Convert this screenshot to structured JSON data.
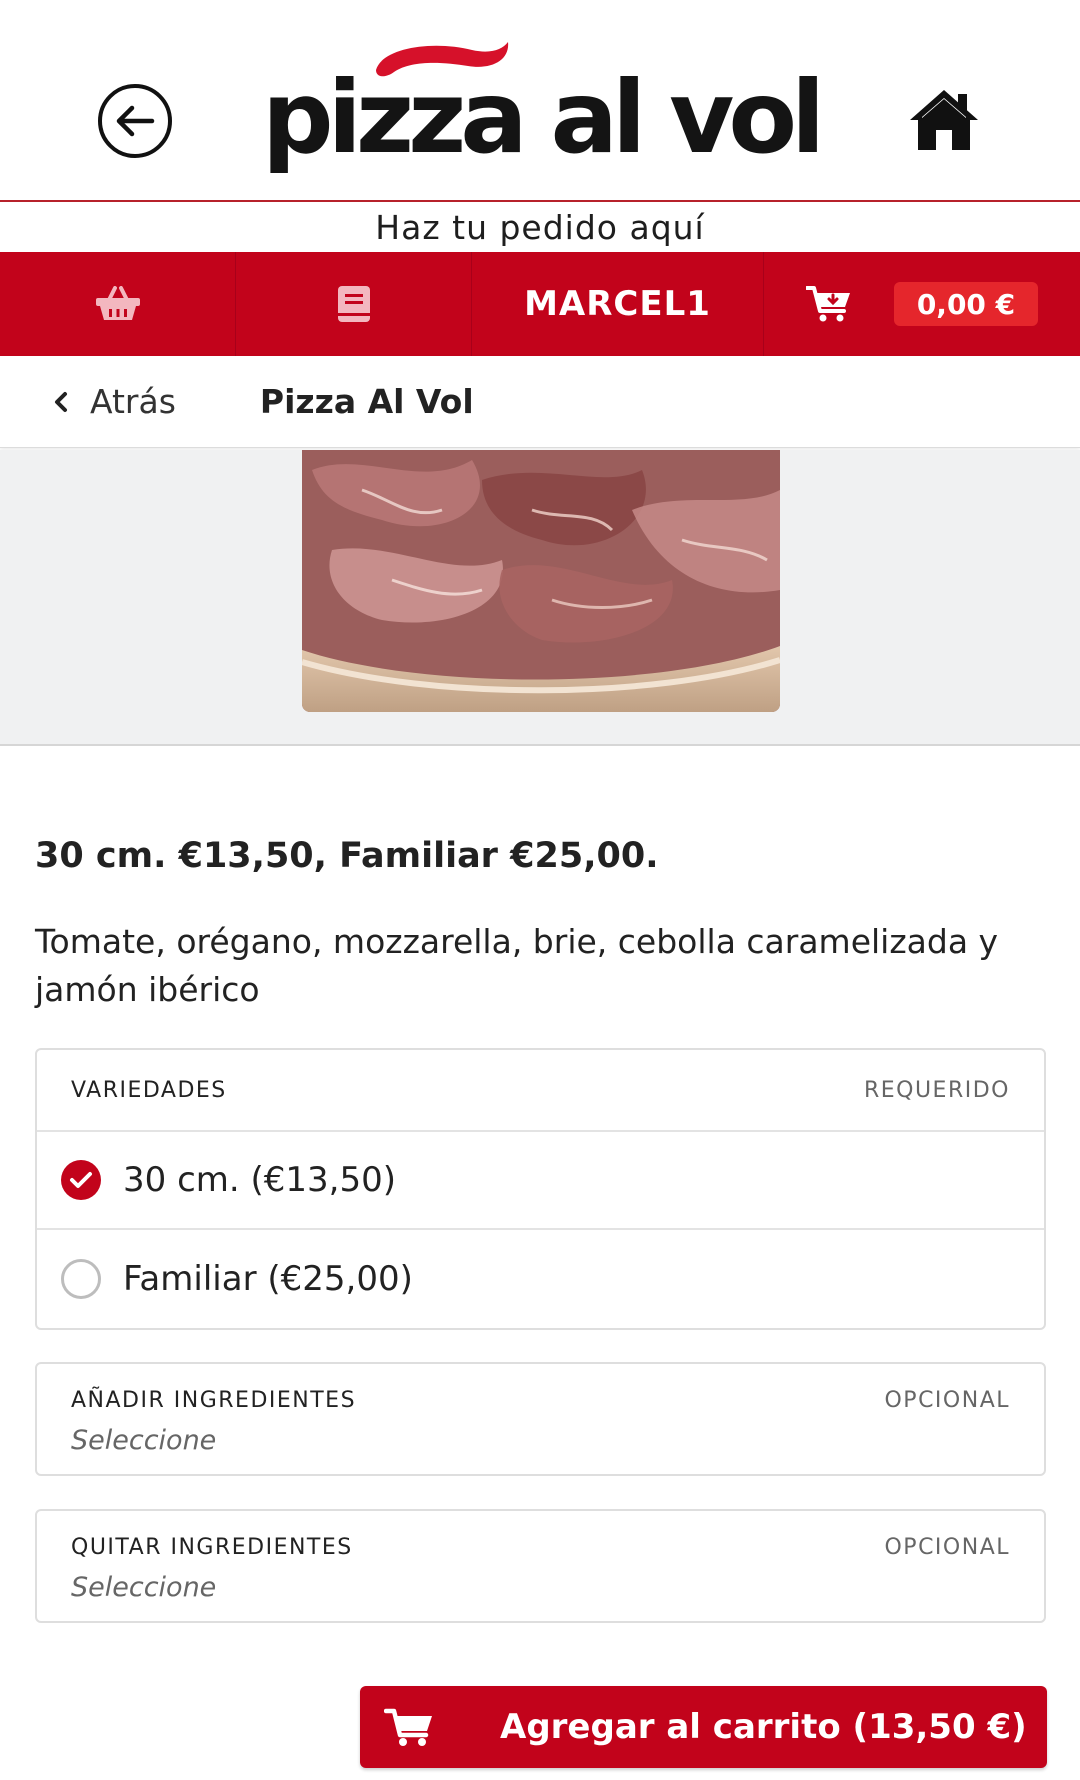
{
  "header": {
    "logo_text": "pizza al vol",
    "tagline": "Haz tu pedido aquí",
    "icons": {
      "back": "arrow-left-circle-icon",
      "home": "home-icon"
    }
  },
  "navbar": {
    "basket_icon": "basket-icon",
    "menu_icon": "book-icon",
    "user": "MARCEL1",
    "cart_icon": "cart-download-icon",
    "cart_total": "0,00 €"
  },
  "subheader": {
    "back_label": "Atrás",
    "title": "Pizza Al Vol"
  },
  "product": {
    "price_line": "30 cm. €13,50, Familiar €25,00.",
    "description": "Tomate, orégano, mozzarella, brie, cebolla caramelizada y jamón ibérico"
  },
  "variedades": {
    "title": "VARIEDADES",
    "tag": "REQUERIDO",
    "options": [
      {
        "label": "30 cm. (€13,50)",
        "selected": true
      },
      {
        "label": "Familiar (€25,00)",
        "selected": false
      }
    ]
  },
  "add_ingredients": {
    "title": "AÑADIR INGREDIENTES",
    "tag": "OPCIONAL",
    "placeholder": "Seleccione"
  },
  "remove_ingredients": {
    "title": "QUITAR INGREDIENTES",
    "tag": "OPCIONAL",
    "placeholder": "Seleccione"
  },
  "add_to_cart": {
    "label": "Agregar al carrito (13,50 €)"
  },
  "colors": {
    "brand_red": "#c2031b",
    "badge_red": "#e5262c"
  }
}
